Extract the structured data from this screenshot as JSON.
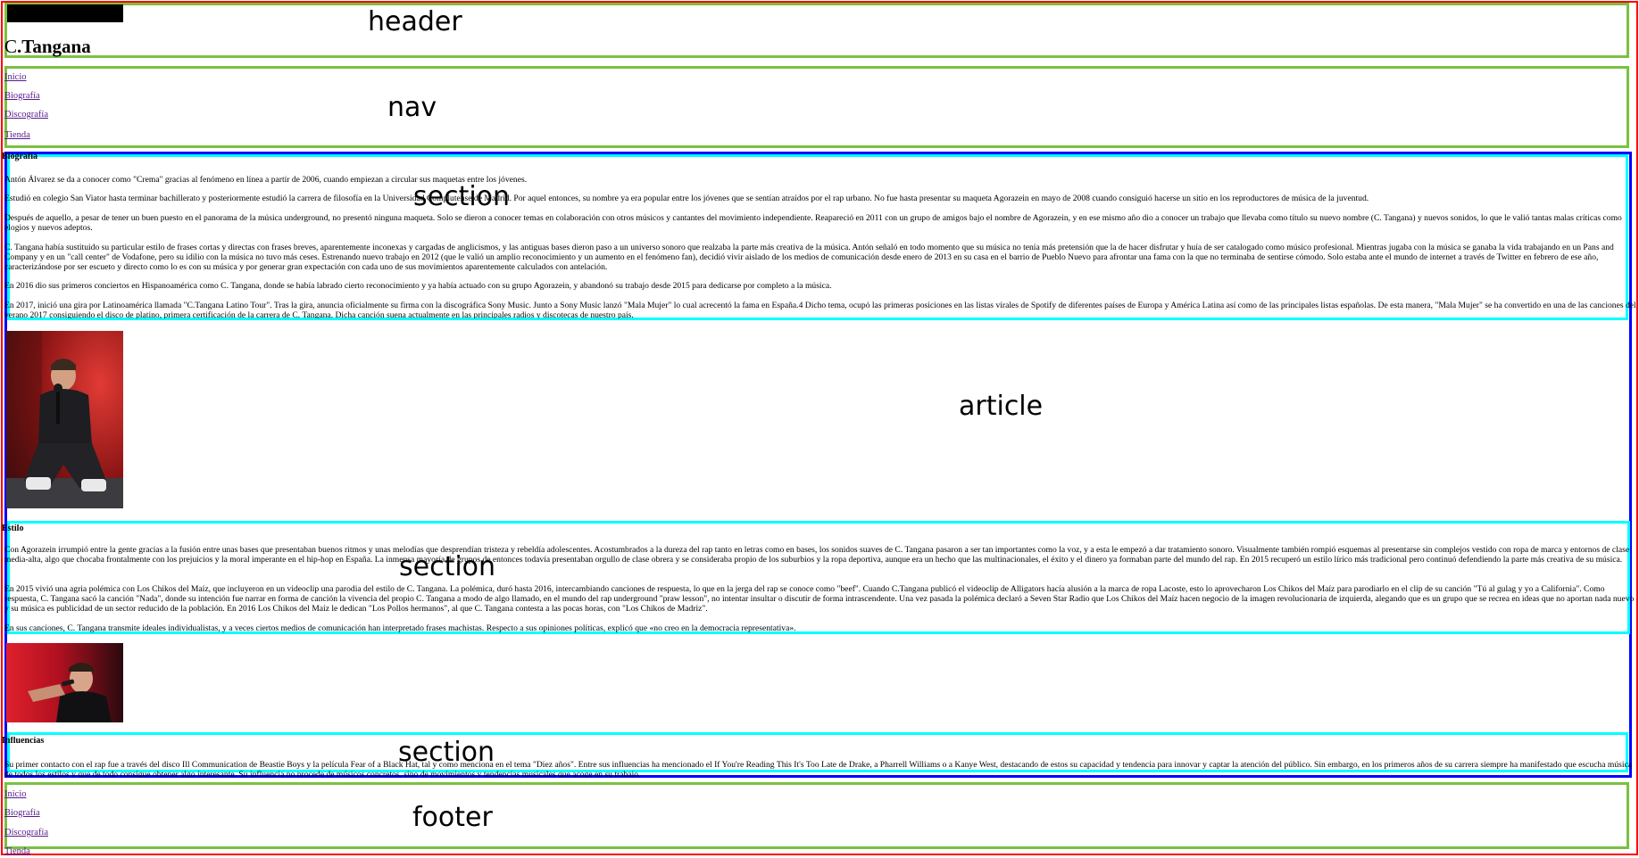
{
  "overlay_labels": {
    "header": "header",
    "nav": "nav",
    "section1": "section",
    "article": "article",
    "section2": "section",
    "section3": "section",
    "footer": "footer"
  },
  "colors": {
    "page_outline": "#ff0000",
    "landmark_outline": "#7ac142",
    "article_outline": "#0000ff",
    "section_outline": "#00ffff",
    "link": "#551a8b"
  },
  "header": {
    "title_prefix": "C",
    "title_rest": ".Tangana"
  },
  "nav": {
    "items": [
      "Inicio",
      "Biografía",
      "Discografía",
      "Tienda"
    ]
  },
  "biografia": {
    "title": "Biografía",
    "paragraphs": [
      "Antón Álvarez se da a conocer como \"Crema\" gracias al fenómeno en línea a partir de 2006, cuando empiezan a circular sus maquetas entre los jóvenes.",
      "Estudió en colegio San Viator hasta terminar bachillerato y posteriormente estudió la carrera de filosofía en la Universidad Complutense de Madrid. Por aquel entonces, su nombre ya era popular entre los jóvenes que se sentían atraídos por el rap urbano. No fue hasta presentar su maqueta Agorazein en mayo de 2008 cuando consiguió hacerse un sitio en los reproductores de música de la juventud.",
      "Después de aquello, a pesar de tener un buen puesto en el panorama de la música underground, no presentó ninguna maqueta. Solo se dieron a conocer temas en colaboración con otros músicos y cantantes del movimiento independiente. Reapareció en 2011 con un grupo de amigos bajo el nombre de Agorazein, y en ese mismo año dio a conocer un trabajo que llevaba como título su nuevo nombre (C. Tangana) y nuevos sonidos, lo que le valió tantas malas críticas como elogios y nuevos adeptos.",
      "C. Tangana había sustituido su particular estilo de frases cortas y directas con frases breves, aparentemente inconexas y cargadas de anglicismos, y las antiguas bases dieron paso a un universo sonoro que realzaba la parte más creativa de la música. Antón señaló en todo momento que su música no tenía más pretensión que la de hacer disfrutar y huía de ser catalogado como músico profesional. Mientras jugaba con la música se ganaba la vida trabajando en un Pans and Company y en un \"call center\" de Vodafone, pero su idilio con la música no tuvo más ceses. Estrenando nuevo trabajo en 2012 (que le valió un amplio reconocimiento y un aumento en el fenómeno fan), decidió vivir aislado de los medios de comunicación desde enero de 2013 en su casa en el barrio de Pueblo Nuevo para afrontar una fama con la que no terminaba de sentirse cómodo. Solo estaba ante el mundo de internet a través de Twitter en febrero de ese año, caracterizándose por ser escueto y directo como lo es con su música y por generar gran expectación con cada uno de sus movimientos aparentemente calculados con antelación.",
      "En 2016 dio sus primeros conciertos en Hispanoamérica como C. Tangana, donde se había labrado cierto reconocimiento y ya había actuado con su grupo Agorazein, y abandonó su trabajo desde 2015 para dedicarse por completo a la música.",
      "En 2017, inició una gira por Latinoamérica llamada \"C.Tangana Latino Tour\". Tras la gira, anuncia oficialmente su firma con la discográfica Sony Music. Junto a Sony Music lanzó \"Mala Mujer\" lo cual acrecentó la fama en España.4 Dicho tema, ocupó las primeras posiciones en las listas virales de Spotify de diferentes países de Europa y América Latina así como de las principales listas españolas. De esta manera, \"Mala Mujer\" se ha convertido en una de las canciones del verano 2017 consiguiendo el disco de platino, primera certificación de la carrera de C. Tangana. Dicha canción suena actualmente en las principales radios y discotecas de nuestro país."
    ]
  },
  "estilo": {
    "title": "Estilo",
    "paragraphs": [
      "Con Agorazein irrumpió entre la gente gracias a la fusión entre unas bases que presentaban buenos ritmos y unas melodías que desprendían tristeza y rebeldía adolescentes. Acostumbrados a la dureza del rap tanto en letras como en bases, los sonidos suaves de C. Tangana pasaron a ser tan importantes como la voz, y a esta le empezó a dar tratamiento sonoro. Visualmente también rompió esquemas al presentarse sin complejos vestido con ropa de marca y entornos de clase media-alta, algo que chocaba frontalmente con los prejuicios y la moral imperante en el hip-hop en España. La inmensa mayoría de grupos de entonces todavía presentaban orgullo de clase obrera y se consideraba propio de los suburbios y la ropa deportiva, aunque era un hecho que las multinacionales, el éxito y el dinero ya formaban parte del mundo del rap. En 2015 recuperó un estilo lírico más tradicional pero continuó defendiendo la parte más creativa de su música.",
      "En 2015 vivió una agria polémica con Los Chikos del Maíz, que incluyeron en un videoclip una parodia del estilo de C. Tangana. La polémica, duró hasta 2016, intercambiando canciones de respuesta, lo que en la jerga del rap se conoce como \"beef\". Cuando C.Tangana publicó el videoclip de Alligators hacía alusión a la marca de ropa Lacoste, esto lo aprovecharon Los Chikos del Maíz para parodiarlo en el clip de su canción \"Tú al gulag y yo a California\". Como respuesta, C. Tangana sacó la canción \"Nada\", donde su intención fue narrar en forma de canción la vivencia del propio C. Tangana a modo de algo llamado, en el mundo del rap underground \"praw lesson\", no intentar insultar o discutir de forma intrascendente. Una vez pasada la polémica declaró a Seven Star Radio que Los Chikos del Maíz hacen negocio de la imagen revolucionaria de izquierda, alegando que es un grupo que se recrea en ideas que no aportan nada nuevo y su música es publicidad de un sector reducido de la población. En 2016 Los Chikos del Maíz le dedican \"Los Pollos hermanos\", al que C. Tangana contesta a las pocas horas, con \"Los Chikos de Madriz\".",
      "En sus canciones, C. Tangana transmite ideales individualistas, y a veces ciertos medios de comunicación han interpretado frases machistas. Respecto a sus opiniones políticas, explicó que «no creo en la democracia representativa»."
    ]
  },
  "influencias": {
    "title": "Influencias",
    "paragraphs": [
      "Su primer contacto con el rap fue a través del disco Ill Communication de Beastie Boys y la película Fear of a Black Hat, tal y como menciona en el tema \"Diez años\". Entre sus influencias ha mencionado el If You're Reading This It's Too Late de Drake, a Pharrell Williams o a Kanye West, destacando de estos su capacidad y tendencia para innovar y captar la atención del público. Sin embargo, en los primeros años de su carrera siempre ha manifestado que escucha música de todos los estilos y que de todo consigue obtener algo interesante. Su influencia no procede de músicos concretos, sino de movimientos y tendencias musicales que acoge en su trabajo."
    ]
  },
  "footer": {
    "items": [
      "Inicio",
      "Biografía",
      "Discografía",
      "Tienda"
    ]
  }
}
